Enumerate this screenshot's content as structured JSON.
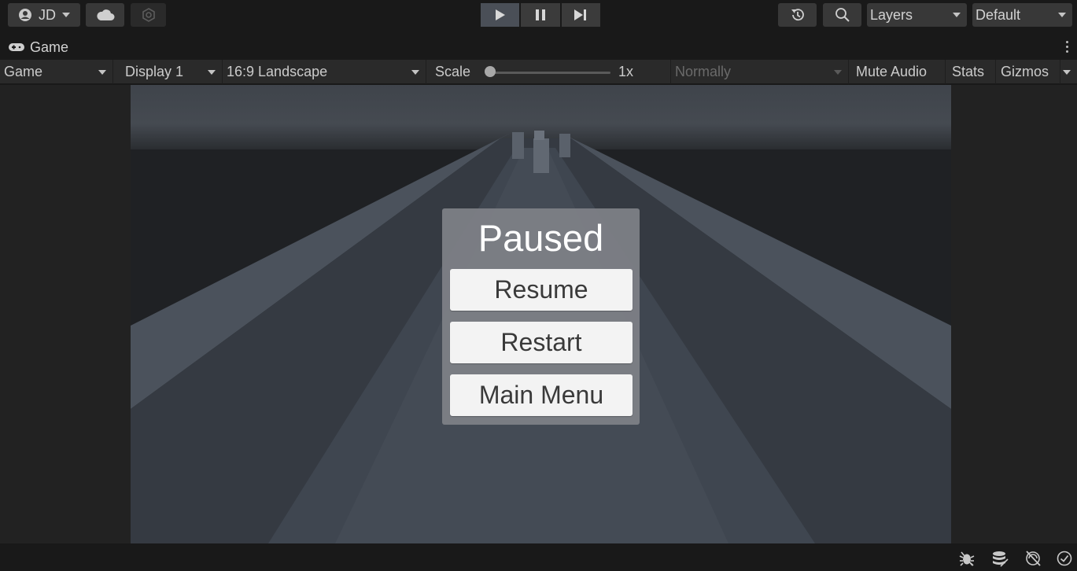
{
  "toolbar": {
    "account_label": "JD",
    "account_icon": "account-icon",
    "cloud_icon": "cloud-icon",
    "collab_icon": "collab-icon",
    "play_icon": "play-icon",
    "pause_icon": "pause-icon",
    "step_icon": "step-icon",
    "history_icon": "history-icon",
    "search_icon": "search-icon",
    "layers_label": "Layers",
    "layout_label": "Default"
  },
  "tab": {
    "label": "Game",
    "icon": "gamepad-icon"
  },
  "gamebar": {
    "mode": "Game",
    "display": "Display 1",
    "aspect": "16:9 Landscape",
    "scale_label": "Scale",
    "scale_value": "1x",
    "play_focus": "Normally",
    "mute_audio": "Mute Audio",
    "stats": "Stats",
    "gizmos": "Gizmos"
  },
  "pause_menu": {
    "title": "Paused",
    "buttons": [
      "Resume",
      "Restart",
      "Main Menu"
    ]
  },
  "colors": {
    "editor_bg": "#191919",
    "bar_bg": "#2a2a2a",
    "panel_bg": "#7d8086",
    "button_bg": "#f3f3f3",
    "play_active": "#4a4f57"
  },
  "statusbar": {
    "icons": [
      "debug-icon",
      "cache-icon",
      "auto-generate-lighting-icon",
      "progress-ok-icon"
    ]
  }
}
